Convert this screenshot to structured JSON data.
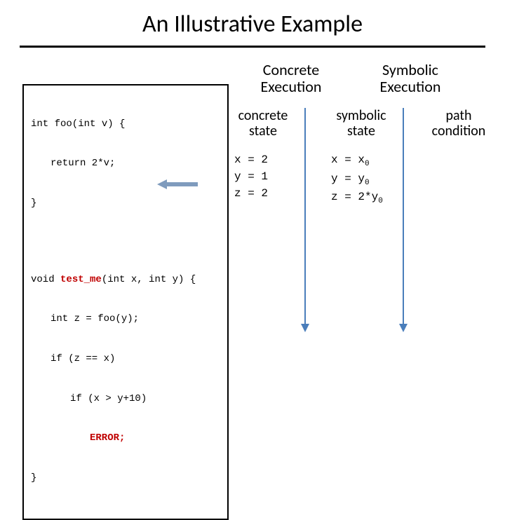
{
  "title": "An Illustrative Example",
  "code": {
    "l1": "int foo(int v) {",
    "l2": "return 2*v;",
    "l3": "}",
    "l4a": "void ",
    "l4b": "test_me",
    "l4c": "(int x, int y) {",
    "l5": "int z = foo(y);",
    "l6": "if (z == x)",
    "l7": "if (x > y+10)",
    "l8": "ERROR;",
    "l9": "}"
  },
  "headings": {
    "concrete": "Concrete Execution",
    "symbolic": "Symbolic Execution",
    "cstate": "concrete state",
    "sstate": "symbolic state",
    "path": "path condition"
  },
  "concrete_vals": {
    "x": "x = 2",
    "y": "y = 1",
    "z": "z = 2"
  },
  "symbolic_vals": {
    "x_pre": "x = x",
    "y_pre": "y = y",
    "z_pre": "z = 2*y",
    "sub": "0"
  }
}
